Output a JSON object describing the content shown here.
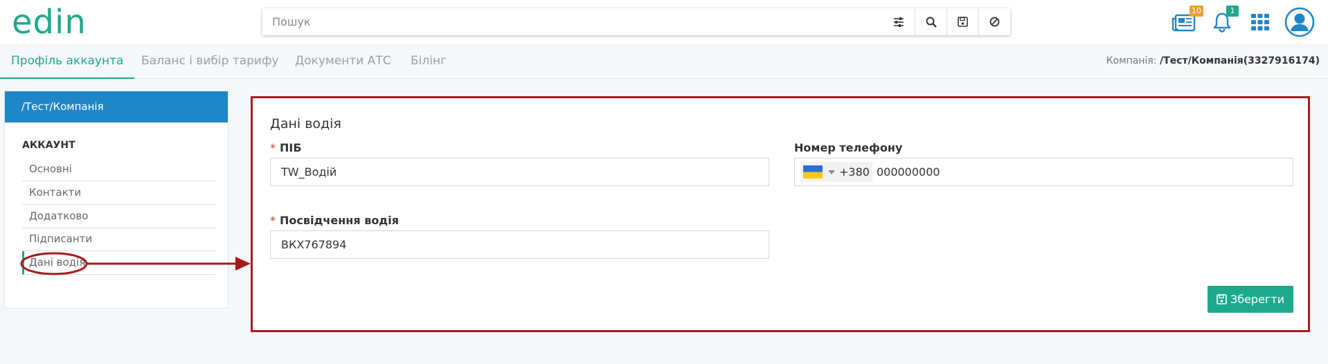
{
  "header": {
    "logo_text": "edin",
    "search": {
      "placeholder": "Пошук",
      "value": ""
    },
    "messages_badge": "10",
    "notifications_badge": "1"
  },
  "tabs": [
    {
      "label": "Профіль аккаунта",
      "active": true
    },
    {
      "label": "Баланс і вибір тарифу",
      "active": false
    },
    {
      "label": "Документи АТС",
      "active": false
    },
    {
      "label": "Білінг",
      "active": false
    }
  ],
  "company": {
    "label": "Компанія:",
    "value": "/Тест/Компанія(3327916174)"
  },
  "sidebar": {
    "header": "/Тест/Компанія",
    "section": "АККАУНТ",
    "items": [
      {
        "label": "Основні"
      },
      {
        "label": "Контакти"
      },
      {
        "label": "Додатково"
      },
      {
        "label": "Підписанти"
      },
      {
        "label": "Дані водія",
        "active": true
      }
    ]
  },
  "form": {
    "title": "Дані водія",
    "required_mark": "*",
    "name": {
      "label": "ПІБ",
      "value": "TW_Водій"
    },
    "phone": {
      "label": "Номер телефону",
      "country_code": "+380",
      "number": "000000000"
    },
    "license": {
      "label": "Посвідчення водія",
      "value": "ВКХ767894"
    },
    "save_label": "Зберегти"
  },
  "colors": {
    "accent": "#1ea98c",
    "sidebar_header": "#1f86c8",
    "highlight": "#a51c1c",
    "badge_orange": "#f0a030",
    "badge_green": "#1ea98c"
  },
  "icons": {
    "filter": "sliders-icon",
    "search": "search-icon",
    "save": "floppy-disk-icon",
    "clear": "ban-icon",
    "messages": "newspaper-icon",
    "notifications": "bell-icon",
    "apps": "grid-icon",
    "user": "user-avatar-icon"
  }
}
